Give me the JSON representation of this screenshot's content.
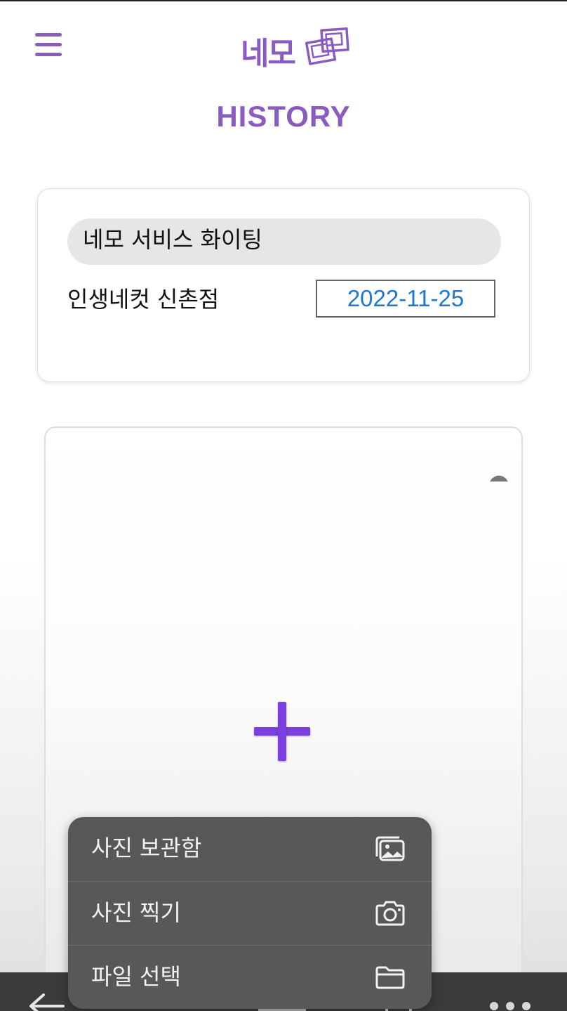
{
  "header": {
    "logo_text": "네모",
    "title": "HISTORY"
  },
  "history_entry": {
    "service": "네모 서비스 화이팅",
    "store": "인생네컷 신촌점",
    "date": "2022-11-25"
  },
  "photo_upload": {
    "add_icon": "plus-icon"
  },
  "picker_menu": {
    "items": [
      {
        "label": "사진 보관함",
        "icon": "photo-library-icon"
      },
      {
        "label": "사진 찍기",
        "icon": "camera-icon"
      },
      {
        "label": "파일 선택",
        "icon": "folder-icon"
      }
    ]
  },
  "colors": {
    "brand_purple": "#8a5cc0",
    "plus_purple": "#7b3fe0",
    "date_blue": "#1e78d2",
    "menu_bg": "#585858"
  }
}
